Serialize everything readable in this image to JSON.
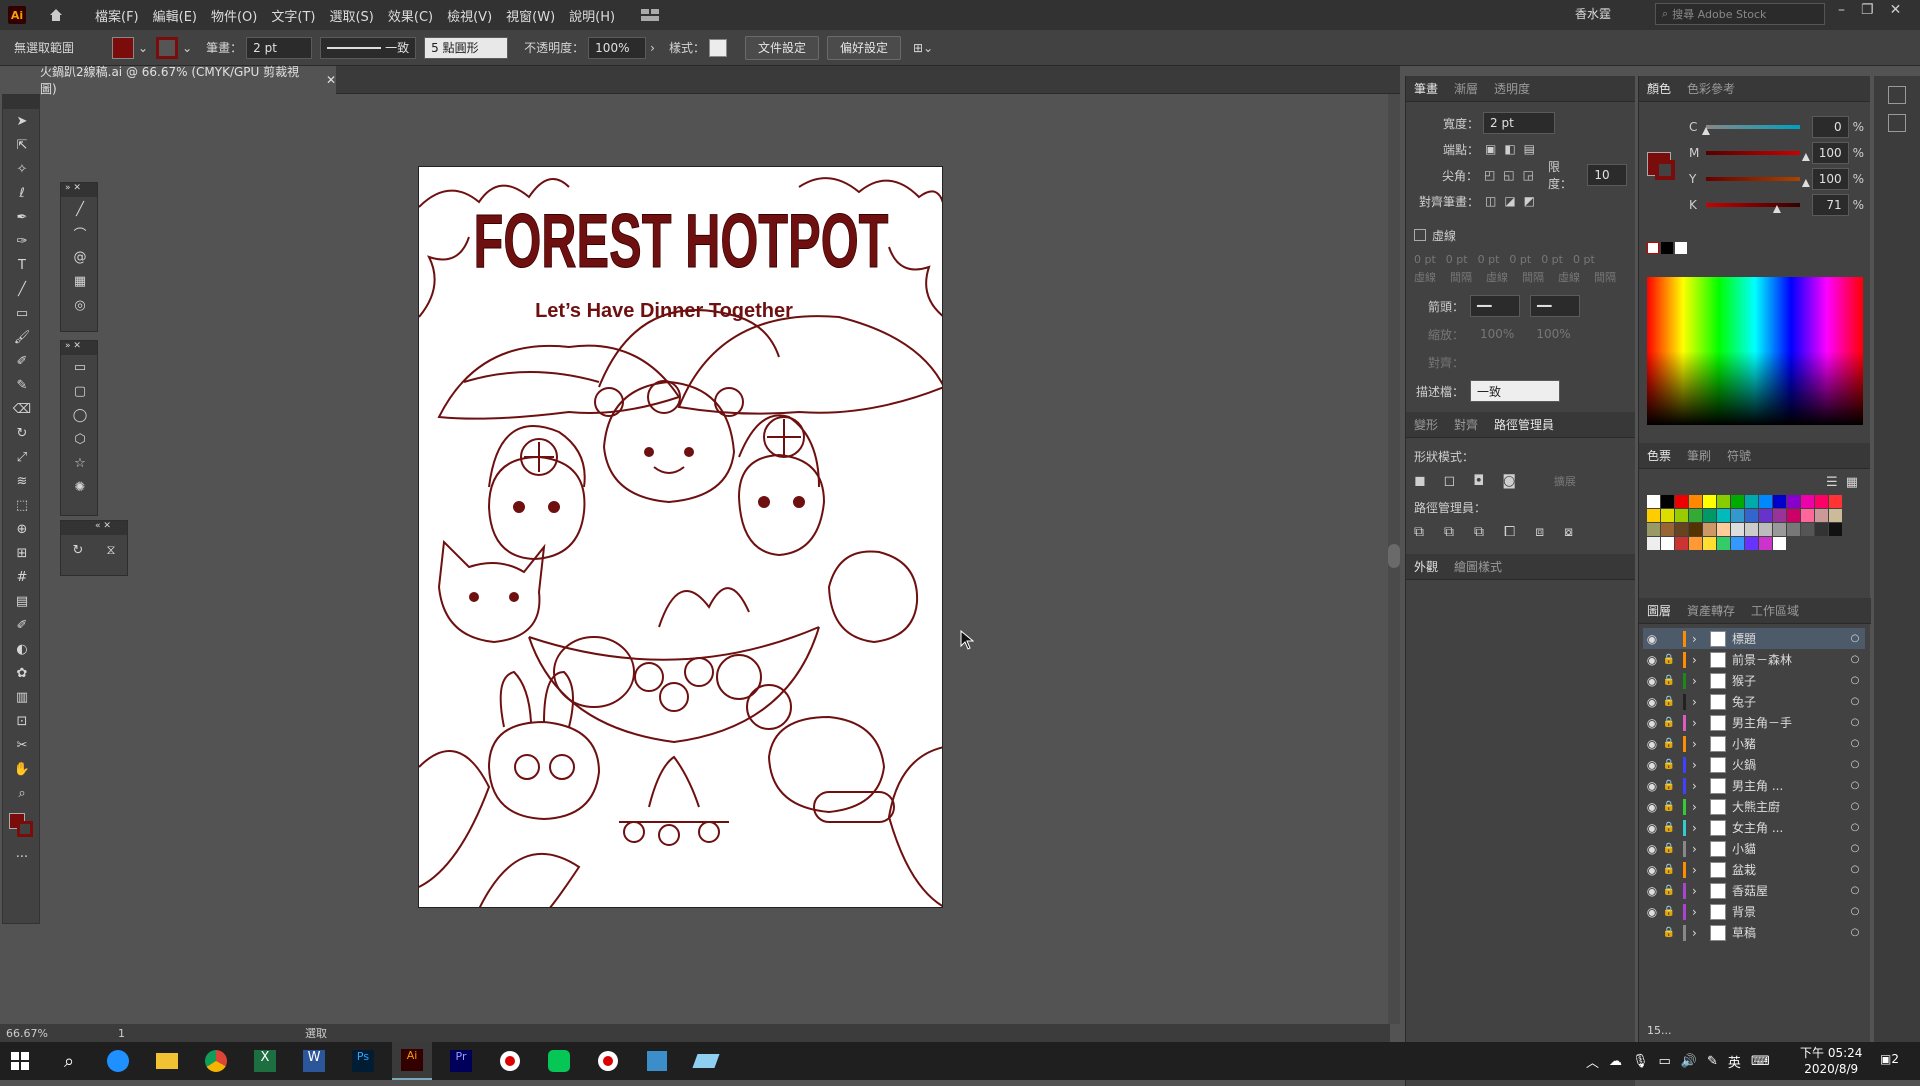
{
  "menubar": {
    "app_logo": "Ai",
    "items": [
      "檔案(F)",
      "編輯(E)",
      "物件(O)",
      "文字(T)",
      "選取(S)",
      "效果(C)",
      "檢視(V)",
      "視窗(W)",
      "說明(H)"
    ],
    "workspace": "香水霆",
    "search_placeholder": "搜尋 Adobe Stock"
  },
  "control": {
    "selection": "無選取範圍",
    "stroke_label": "筆畫：",
    "stroke_value": "2 pt",
    "stroke_style": "一致",
    "brush": "5 點圓形",
    "opacity_label": "不透明度：",
    "opacity_value": "100%",
    "style_label": "樣式：",
    "doc_setup": "文件設定",
    "prefs": "偏好設定",
    "fill_color": "#7a0c0c"
  },
  "document": {
    "tab_title": "火鍋趴2線稿.ai @ 66.67% (CMYK/GPU 剪裁視圖)"
  },
  "artwork": {
    "title": "FOREST HOTPOT",
    "subtitle": "Let’s Have Dinner Together",
    "line_color": "#6e1010"
  },
  "stroke_panel": {
    "tabs": [
      "筆畫",
      "漸層",
      "透明度"
    ],
    "weight_label": "寬度：",
    "weight": "2 pt",
    "cap_label": "端點：",
    "corner_label": "尖角：",
    "limit_label": "限度：",
    "limit": "10",
    "align_label": "對齊筆畫：",
    "dashed_label": "虛線",
    "dash_values": [
      "0 pt",
      "0 pt",
      "0 pt",
      "0 pt",
      "0 pt",
      "0 pt"
    ],
    "dash_labels": [
      "虛線",
      "間隔",
      "虛線",
      "間隔",
      "虛線",
      "間隔"
    ],
    "arrow_label": "箭頭：",
    "scale_label": "縮放：",
    "scale_values": [
      "100%",
      "100%"
    ],
    "align2_label": "對齊：",
    "profile_label": "描述檔：",
    "profile_value": "一致"
  },
  "pathfinder": {
    "tabs": [
      "變形",
      "對齊",
      "路徑管理員"
    ],
    "shape_modes": "形狀模式：",
    "apply": "擴展",
    "pathfinders": "路徑管理員："
  },
  "appearance": {
    "tabs": [
      "外觀",
      "繪圖樣式"
    ]
  },
  "color_panel": {
    "tabs": [
      "顏色",
      "色彩參考"
    ],
    "channels": [
      {
        "name": "C",
        "value": "0"
      },
      {
        "name": "M",
        "value": "100"
      },
      {
        "name": "Y",
        "value": "100"
      },
      {
        "name": "K",
        "value": "71"
      }
    ],
    "unit": "%"
  },
  "swatches": {
    "tabs": [
      "色票",
      "筆刷",
      "符號"
    ]
  },
  "layers": {
    "tabs": [
      "圖層",
      "資產轉存",
      "工作區域"
    ],
    "items": [
      {
        "name": "標題",
        "color": "#ff8c00"
      },
      {
        "name": "前景－森林",
        "color": "#ff8c00"
      },
      {
        "name": "猴子",
        "color": "#1a8a1a"
      },
      {
        "name": "兔子",
        "color": "#222222"
      },
      {
        "name": "男主角－手",
        "color": "#e05ac0"
      },
      {
        "name": "小豬",
        "color": "#ff8c00"
      },
      {
        "name": "火鍋",
        "color": "#4040ff"
      },
      {
        "name": "男主角 ...",
        "color": "#4040ff"
      },
      {
        "name": "大熊主廚",
        "color": "#33cc33"
      },
      {
        "name": "女主角 ...",
        "color": "#33cccc"
      },
      {
        "name": "小貓",
        "color": "#888888"
      },
      {
        "name": "盆栽",
        "color": "#ff8c00"
      },
      {
        "name": "香菇屋",
        "color": "#aa44cc"
      },
      {
        "name": "背景",
        "color": "#aa44cc"
      },
      {
        "name": "草稿",
        "color": "#888888"
      }
    ],
    "count": "15..."
  },
  "status": {
    "zoom": "66.67%",
    "page": "1",
    "mode": "選取"
  },
  "taskbar": {
    "time": "下午 05:24",
    "date": "2020/8/9",
    "ime": "英",
    "notify": "2"
  }
}
